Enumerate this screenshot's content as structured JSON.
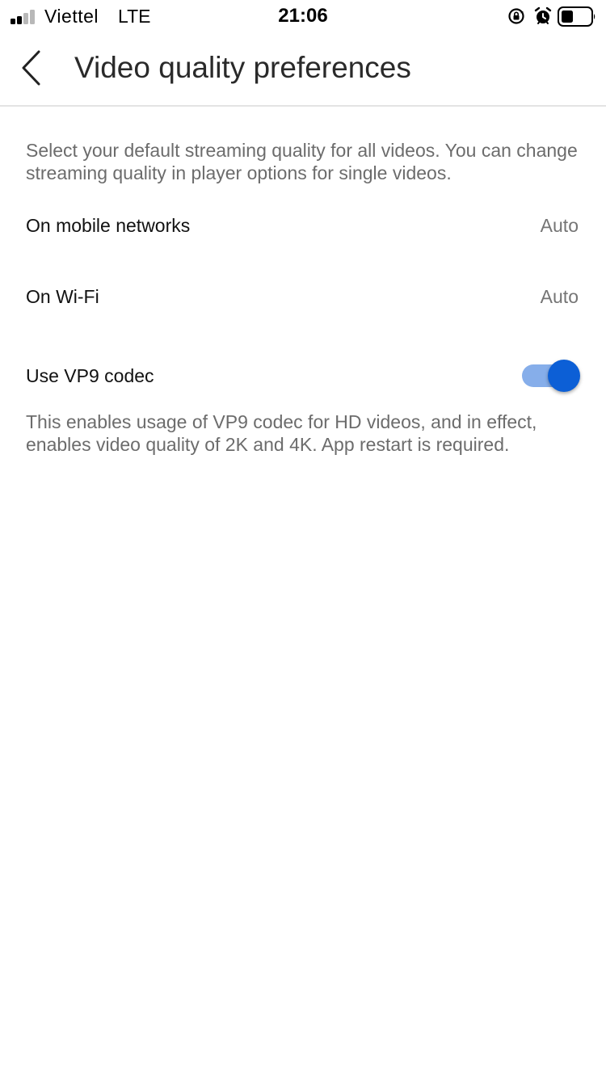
{
  "status_bar": {
    "carrier": "Viettel",
    "network": "LTE",
    "time": "21:06",
    "signal_bars_filled": 2,
    "signal_bars_total": 4,
    "battery_level": 0.4
  },
  "header": {
    "title": "Video quality preferences"
  },
  "content": {
    "description": "Select your default streaming quality for all videos. You can change streaming quality in player options for single videos.",
    "mobile_networks": {
      "label": "On mobile networks",
      "value": "Auto"
    },
    "wifi": {
      "label": "On Wi-Fi",
      "value": "Auto"
    },
    "vp9": {
      "label": "Use VP9 codec",
      "enabled": true,
      "description": "This enables usage of VP9 codec for HD videos, and in effect, enables video quality of 2K and 4K. App restart is required."
    }
  },
  "colors": {
    "accent": "#0c5fd6",
    "accent_track": "#86aeea",
    "secondary_text": "#6c6c6c"
  }
}
